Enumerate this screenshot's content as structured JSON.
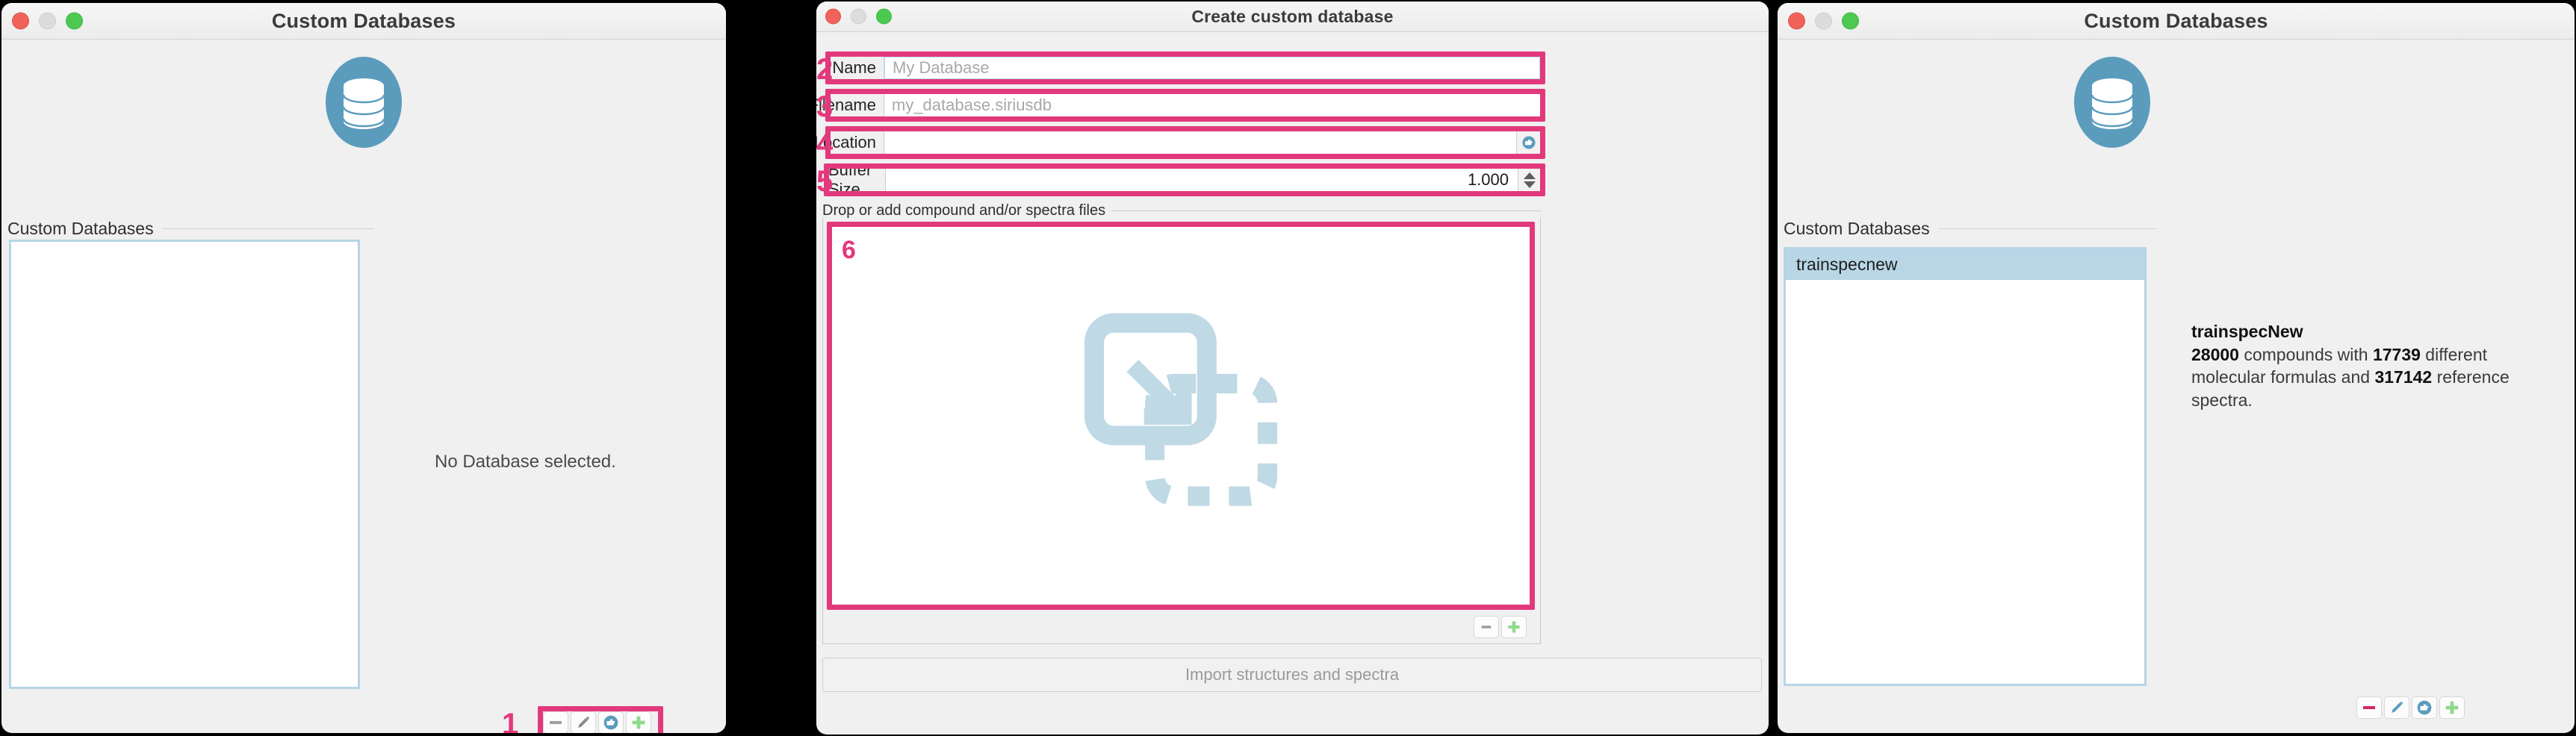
{
  "colors": {
    "annotation_pink": "#e2397c",
    "db_logo_blue": "#5b9cbd",
    "list_selection_blue": "#b8d6e5",
    "drop_icon_blue": "#bfd9e5",
    "add_green": "#90d98b",
    "remove_red": "#d6285a"
  },
  "left_window": {
    "title": "Custom Databases",
    "traffic_lights": [
      "close-button",
      "minimize-button",
      "maximize-button"
    ],
    "logo_icon": "database-stack-icon",
    "group_label": "Custom Databases",
    "list_items": [],
    "empty_message": "No Database selected.",
    "toolbar": {
      "remove_label": "remove-database",
      "edit_label": "edit-database",
      "open_label": "open-database",
      "add_label": "add-database"
    },
    "annotation": {
      "number": "1"
    }
  },
  "middle_window": {
    "title": "Create custom database",
    "traffic_lights": [
      "close-button",
      "minimize-button",
      "maximize-button"
    ],
    "fields": [
      {
        "number": "2",
        "label": "Name",
        "value": "",
        "placeholder": "My Database"
      },
      {
        "number": "3",
        "label": "Filename",
        "value": "",
        "placeholder": "my_database.siriusdb"
      },
      {
        "number": "4",
        "label": "Location",
        "value": "",
        "placeholder": ""
      },
      {
        "number": "5",
        "label": "Buffer Size",
        "value": "1.000",
        "placeholder": ""
      }
    ],
    "drop_group_label": "Drop or add compound and/or spectra files",
    "drop_icon": "drag-and-drop-import-icon",
    "drop_annotation_number": "6",
    "file_toolbar": {
      "remove_label": "remove-file",
      "add_label": "add-file"
    },
    "import_button_label": "Import structures and spectra"
  },
  "right_window": {
    "title": "Custom Databases",
    "traffic_lights": [
      "close-button",
      "minimize-button",
      "maximize-button"
    ],
    "logo_icon": "database-stack-icon",
    "group_label": "Custom Databases",
    "list_items": [
      {
        "name": "trainspecnew",
        "selected": true
      }
    ],
    "details": {
      "title": "trainspecNew",
      "compounds": "28000",
      "text_compounds": " compounds with ",
      "formulas": "17739",
      "text_formulas": " different molecular formulas and ",
      "spectra": "317142",
      "text_spectra": " reference spectra."
    },
    "toolbar": {
      "remove_label": "remove-database",
      "edit_label": "edit-database",
      "open_label": "open-database",
      "add_label": "add-database"
    }
  }
}
